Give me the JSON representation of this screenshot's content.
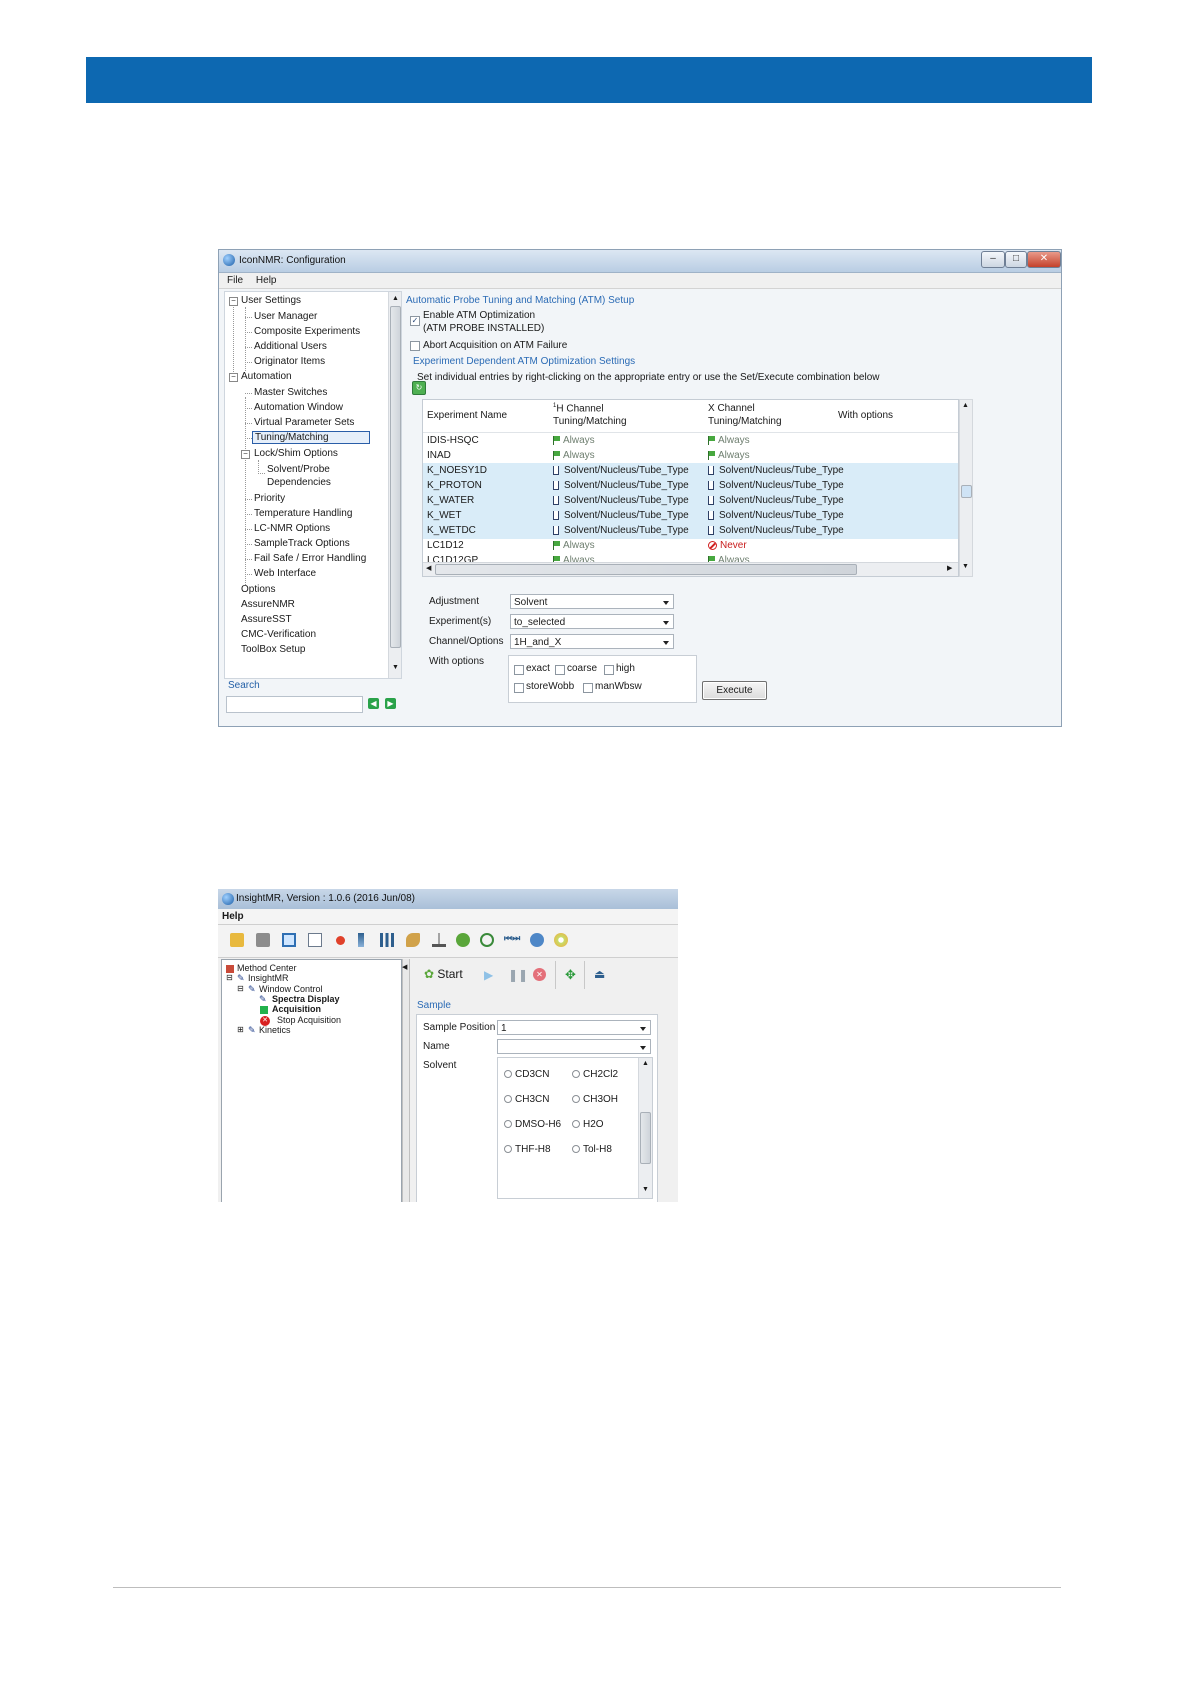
{
  "icon_config": {
    "title": "IconNMR: Configuration",
    "menu": [
      "File",
      "Help"
    ],
    "nav_tree": {
      "groups": [
        {
          "label": "User Settings",
          "items": [
            "User Manager",
            "Composite Experiments",
            "Additional Users",
            "Originator Items"
          ]
        },
        {
          "label": "Automation",
          "items": [
            "Master Switches",
            "Automation Window",
            "Virtual Parameter Sets",
            "Tuning/Matching",
            "Lock/Shim Options",
            "Solvent/Probe",
            "Dependencies",
            "Priority",
            "Temperature Handling",
            "LC-NMR Options",
            "SampleTrack Options",
            "Fail Safe / Error Handling",
            "Web Interface"
          ]
        }
      ],
      "top_items": [
        "Options",
        "AssureNMR",
        "AssureSST",
        "CMC-Verification",
        "ToolBox Setup"
      ],
      "selected": "Tuning/Matching"
    },
    "search_label": "Search",
    "atm_title": "Automatic Probe Tuning and Matching (ATM) Setup",
    "enable_atm_line1": "Enable ATM Optimization",
    "enable_atm_line2": "(ATM PROBE INSTALLED)",
    "enable_atm_checked": true,
    "abort_label": "Abort Acquisition on ATM Failure",
    "abort_checked": false,
    "exp_settings_title": "Experiment Dependent ATM Optimization Settings",
    "instruction": "Set individual entries by right-clicking on the appropriate entry or use the Set/Execute combination below",
    "table": {
      "col_name": "Experiment Name",
      "col_h_sup": "1",
      "col_h_line1": "H Channel",
      "col_h_line2": "Tuning/Matching",
      "col_x_line1": "X Channel",
      "col_x_line2": "Tuning/Matching",
      "col_opts": "With options",
      "rows": [
        {
          "name": "IDIS-HSQC",
          "h": "Always",
          "x": "Always",
          "sel": false
        },
        {
          "name": "INAD",
          "h": "Always",
          "x": "Always",
          "sel": false
        },
        {
          "name": "K_NOESY1D",
          "h": "Solvent/Nucleus/Tube_Type",
          "x": "Solvent/Nucleus/Tube_Type",
          "sel": true
        },
        {
          "name": "K_PROTON",
          "h": "Solvent/Nucleus/Tube_Type",
          "x": "Solvent/Nucleus/Tube_Type",
          "sel": true
        },
        {
          "name": "K_WATER",
          "h": "Solvent/Nucleus/Tube_Type",
          "x": "Solvent/Nucleus/Tube_Type",
          "sel": true
        },
        {
          "name": "K_WET",
          "h": "Solvent/Nucleus/Tube_Type",
          "x": "Solvent/Nucleus/Tube_Type",
          "sel": true
        },
        {
          "name": "K_WETDC",
          "h": "Solvent/Nucleus/Tube_Type",
          "x": "Solvent/Nucleus/Tube_Type",
          "sel": true
        },
        {
          "name": "LC1D12",
          "h": "Always",
          "x": "Never",
          "sel": false
        },
        {
          "name": "LC1D12GP",
          "h": "Always",
          "x": "Always",
          "sel": false
        }
      ]
    },
    "adjustment_label": "Adjustment",
    "adjustment_value": "Solvent",
    "experiments_label": "Experiment(s)",
    "experiments_value": "to_selected",
    "channel_label": "Channel/Options",
    "channel_value": "1H_and_X",
    "with_options_label": "With options",
    "options": {
      "exact": "exact",
      "coarse": "coarse",
      "high": "high",
      "storeWobb": "storeWobb",
      "manWbsw": "manWbsw"
    },
    "execute_label": "Execute",
    "colors": {
      "banner": "#0d68b1",
      "section_title": "#2b6bb5",
      "selected_row": "#d9ecf8"
    }
  },
  "insight_mr": {
    "title": "InsightMR, Version : 1.0.6 (2016 Jun/08)",
    "menu": [
      "Help"
    ],
    "toolbar_icons": [
      "folder-icon",
      "printer-icon",
      "monitor-icon",
      "layout-icon",
      "record-icon",
      "sort-icon",
      "adjust-icon",
      "brush-icon",
      "download-icon",
      "refresh-icon",
      "zoom-icon",
      "step-icon",
      "cloud-icon",
      "disc-icon"
    ],
    "tree": {
      "root": "Method Center",
      "insight": "InsightMR",
      "window_control": "Window Control",
      "spectra_display": "Spectra Display",
      "acquisition": "Acquisition",
      "stop_acquisition": "Stop Acquisition",
      "kinetics": "Kinetics"
    },
    "start_label": "Start",
    "sample_title": "Sample",
    "sample_position_label": "Sample Position",
    "sample_position_value": "1",
    "name_label": "Name",
    "name_value": "",
    "solvent_label": "Solvent",
    "solvents": [
      "CD3CN",
      "CH2Cl2",
      "CH3CN",
      "CH3OH",
      "DMSO-H6",
      "H2O",
      "THF-H8",
      "Tol-H8"
    ]
  }
}
